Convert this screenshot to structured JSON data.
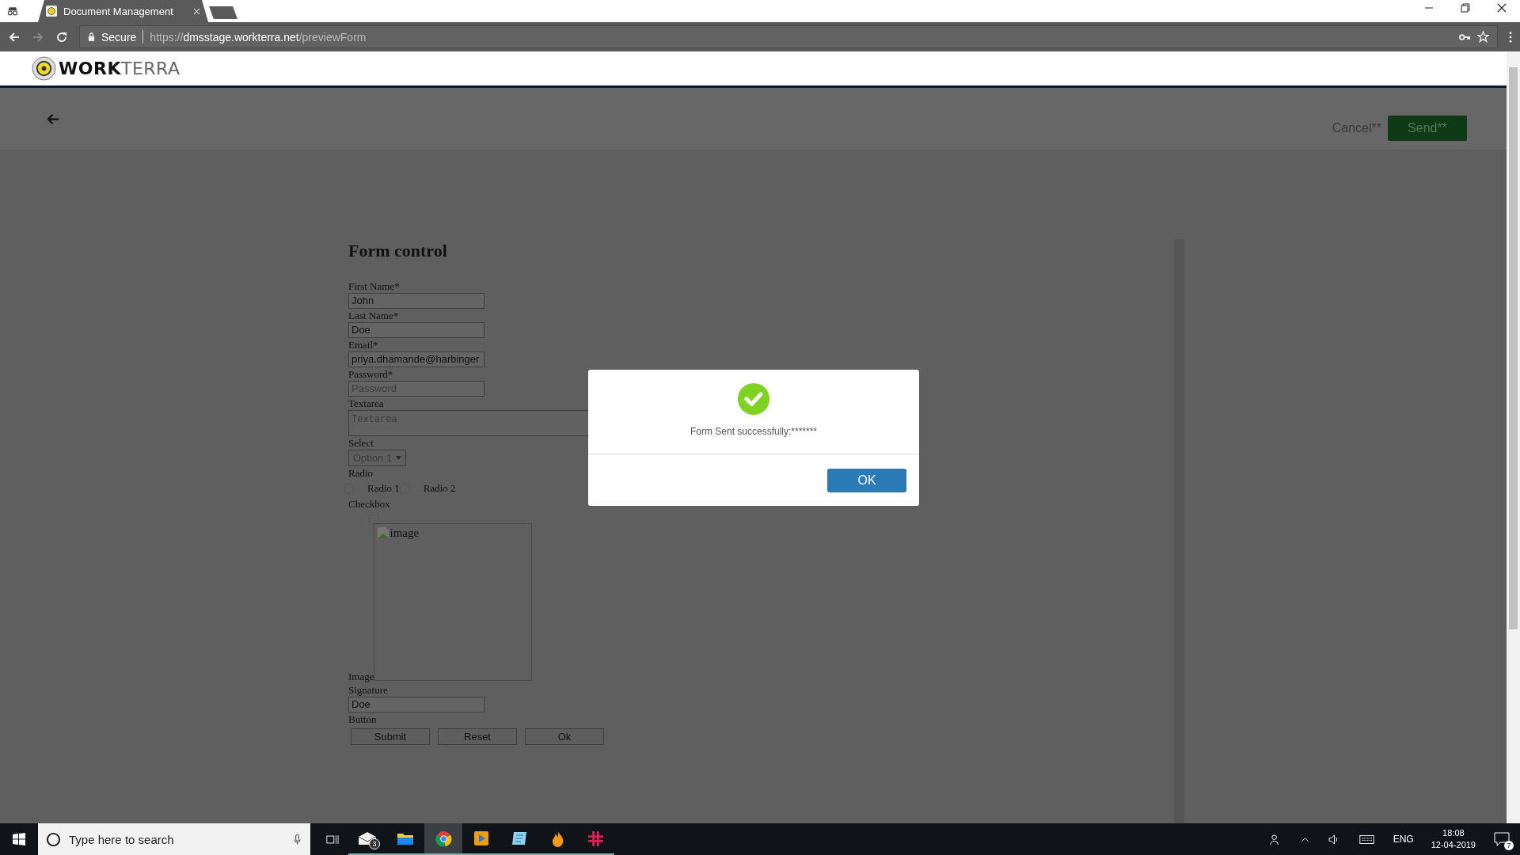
{
  "browser": {
    "tab_title": "Document Management",
    "security": "Secure",
    "url": {
      "scheme": "https://",
      "host": "dmsstage.workterra.net",
      "path": "/previewForm"
    }
  },
  "logo": {
    "bold": "WORK",
    "light": "TERRA"
  },
  "toolbar": {
    "cancel": "Cancel**",
    "send": "Send**"
  },
  "form": {
    "title": "Form control",
    "fields": [
      {
        "kind": "text",
        "label": "First Name*",
        "value": "John"
      },
      {
        "kind": "text",
        "label": "Last Name*",
        "value": "Doe"
      },
      {
        "kind": "text",
        "label": "Email*",
        "value": "priya.dhamande@harbinger"
      },
      {
        "kind": "text",
        "label": "Password*",
        "placeholder": "Password"
      },
      {
        "kind": "textarea",
        "label": "Textarea",
        "placeholder": "Textarea"
      },
      {
        "kind": "select",
        "label": "Select",
        "value": "Option 1"
      },
      {
        "kind": "radio",
        "label": "Radio",
        "options": [
          {
            "label": "Radio 1",
            "selected": false
          },
          {
            "label": "Radio 2",
            "selected": false
          }
        ]
      },
      {
        "kind": "checkbox",
        "label": "Checkbox",
        "checked": false
      },
      {
        "kind": "image",
        "label": "Image",
        "alt": "image"
      },
      {
        "kind": "text",
        "label": "Signature",
        "value": "Doe"
      },
      {
        "kind": "buttons",
        "label": "Button",
        "buttons": [
          "Submit",
          "Reset",
          "Ok"
        ]
      }
    ]
  },
  "dialog": {
    "message": "Form Sent successfully:*******",
    "button": "OK"
  },
  "taskbar": {
    "search_placeholder": "Type here to search",
    "mail_badge": "3",
    "language": "ENG",
    "time": "18:08",
    "date": "12-04-2019",
    "notification_count": "7"
  }
}
